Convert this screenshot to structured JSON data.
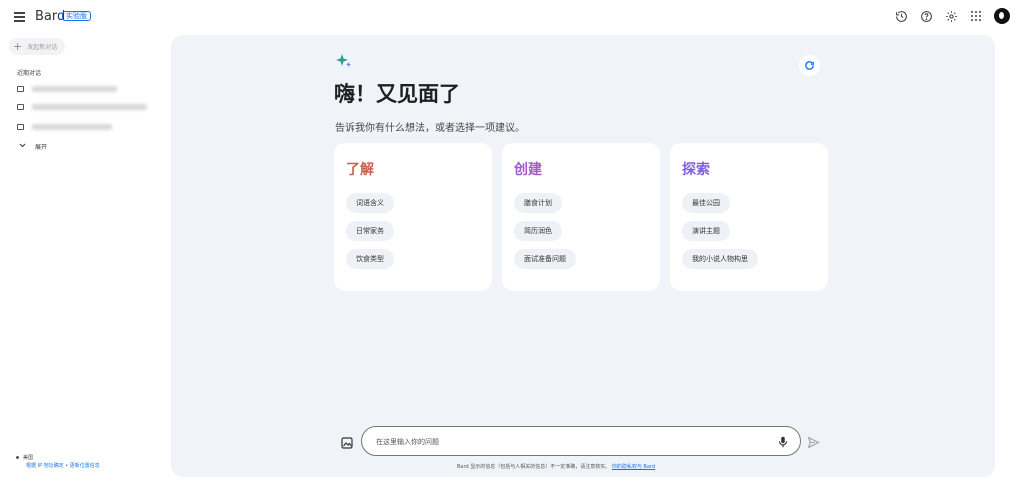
{
  "app": {
    "name": "Bard",
    "badge": "实验版"
  },
  "top_icons": [
    "history-icon",
    "help-icon",
    "settings-icon",
    "apps-icon",
    "avatar"
  ],
  "sidebar": {
    "new_chat": "发起新对话",
    "recent_title": "近期对话",
    "expand_label": "展开",
    "location_title": "美国",
    "location_sub": "根据 IP 地址确定 • 更新位置信息"
  },
  "main": {
    "greeting": "嗨！又见面了",
    "subtitle": "告诉我你有什么想法，或者选择一项建议。",
    "cards": [
      {
        "title": "了解",
        "color": "#c9604f",
        "chips": [
          "词语含义",
          "日常家务",
          "饮食类型"
        ]
      },
      {
        "title": "创建",
        "color": "#a35bc4",
        "chips": [
          "膳食计划",
          "简历润色",
          "面试准备问题"
        ]
      },
      {
        "title": "探索",
        "color": "#7e61d8",
        "chips": [
          "最佳公园",
          "演讲主题",
          "我的小说人物构思"
        ]
      }
    ],
    "input_placeholder": "在这里输入你的问题",
    "disclaimer": "Bard 显示的信息（包括与人相关的信息）不一定准确，请注意核实。",
    "disclaimer_link": "你的隐私权与 Bard"
  },
  "colors": {
    "accent": "#1a73e8",
    "main_bg": "#f0f4f9",
    "sparkle": "#2e9b8f"
  }
}
